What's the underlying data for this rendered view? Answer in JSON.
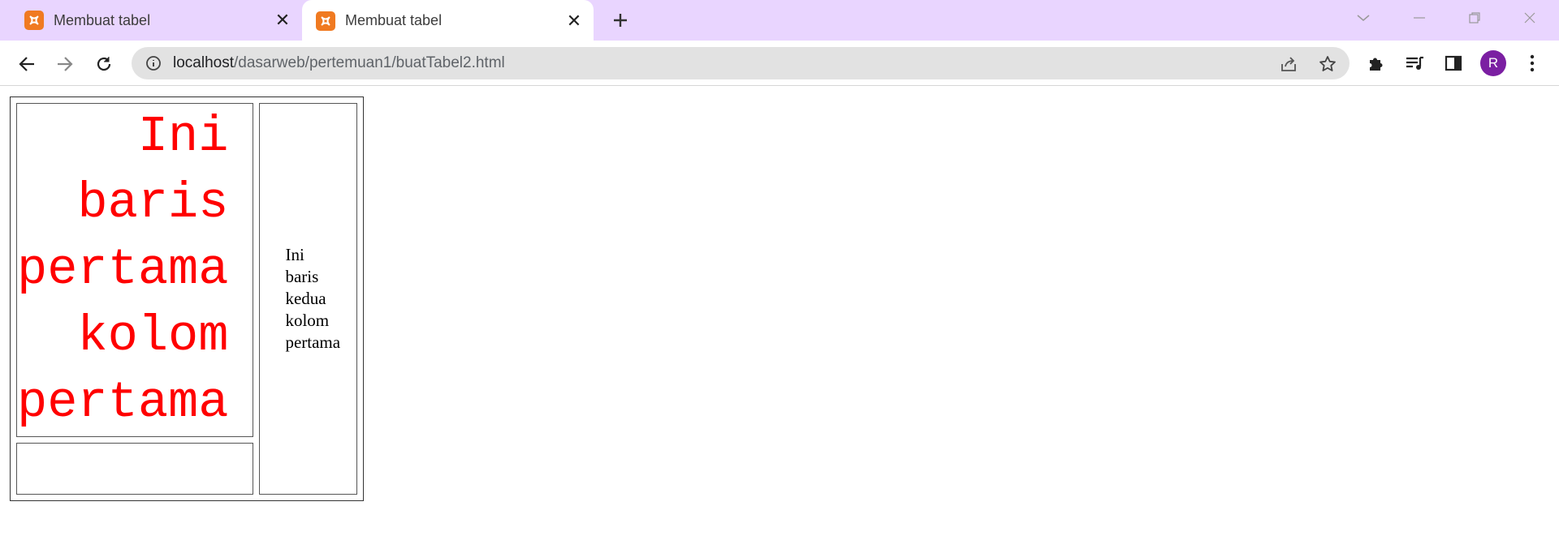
{
  "tabs": [
    {
      "title": "Membuat tabel",
      "active": false
    },
    {
      "title": "Membuat tabel",
      "active": true
    }
  ],
  "omnibox": {
    "host": "localhost",
    "path": "/dasarweb/pertemuan1/buatTabel2.html"
  },
  "profile": {
    "initial": "R",
    "color": "#7b1fa2"
  },
  "colors": {
    "tabstrip": "#e9d5ff",
    "favicon": "#f07a21",
    "cell_text": "#ff0000"
  },
  "page": {
    "cell_1": "Ini baris pertama kolom pertama",
    "cell_2": "Ini baris kedua kolom pertama",
    "cell_3": ""
  }
}
